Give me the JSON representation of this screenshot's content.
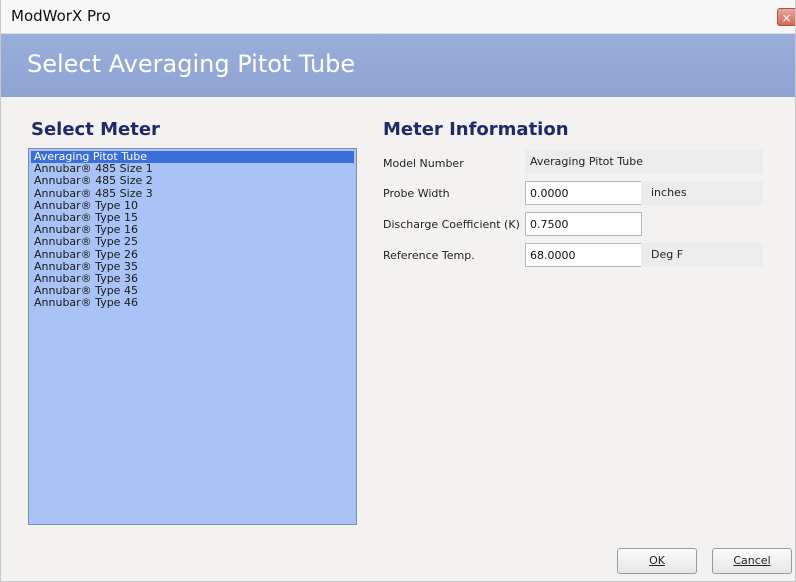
{
  "window": {
    "title": "ModWorX Pro",
    "close_glyph": "×"
  },
  "banner": {
    "heading": "Select Averaging Pitot Tube"
  },
  "select_meter": {
    "title": "Select Meter",
    "selected_index": 0,
    "items": [
      "Averaging Pitot Tube",
      "Annubar® 485 Size 1",
      "Annubar® 485 Size 2",
      "Annubar® 485 Size 3",
      "Annubar® Type 10",
      "Annubar® Type 15",
      "Annubar® Type 16",
      "Annubar® Type 25",
      "Annubar® Type 26",
      "Annubar® Type 35",
      "Annubar® Type 36",
      "Annubar® Type 45",
      "Annubar® Type 46"
    ]
  },
  "meter_info": {
    "title": "Meter Information",
    "model_number_label": "Model Number",
    "model_number_value": "Averaging Pitot Tube",
    "probe_width_label": "Probe Width",
    "probe_width_value": "0.0000",
    "probe_width_unit": "inches",
    "discharge_coeff_label": "Discharge Coefficient (K)",
    "discharge_coeff_value": "0.7500",
    "reference_temp_label": "Reference Temp.",
    "reference_temp_value": "68.0000",
    "reference_temp_unit": "Deg F"
  },
  "buttons": {
    "ok_label": "OK",
    "cancel_label": "Cancel"
  },
  "colors": {
    "banner": "#9aaedb",
    "list_background": "#a9c3f6",
    "list_selection": "#3a6fd8",
    "section_title": "#1f2a6b"
  }
}
